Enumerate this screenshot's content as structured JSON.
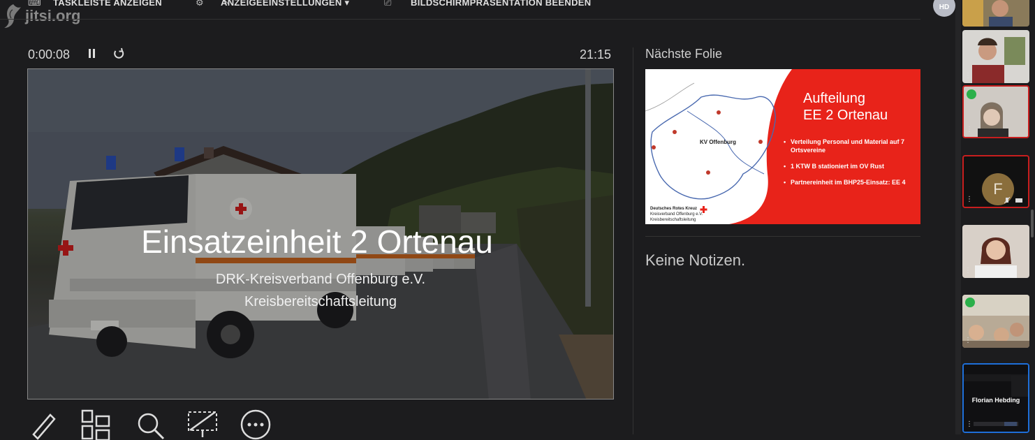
{
  "logo": {
    "text": "jitsi.org"
  },
  "toolbar": {
    "show_taskbar": "TASKLEISTE ANZEIGEN",
    "display_settings": "ANZEIGEEINSTELLUNGEN ▾",
    "end_presentation": "BILDSCHIRMPRÄSENTATION BEENDEN",
    "user_initials": "HD"
  },
  "presenter": {
    "elapsed": "0:00:08",
    "clock": "21:15",
    "next_label": "Nächste Folie",
    "notes": "Keine Notizen."
  },
  "slide": {
    "title": "Einsatzeinheit 2 Ortenau",
    "subtitle1": "DRK-Kreisverband Offenburg e.V.",
    "subtitle2": "Kreisbereitschaftsleitung"
  },
  "next_slide": {
    "title_line1": "Aufteilung",
    "title_line2": "EE 2 Ortenau",
    "bullets": [
      "Verteilung Personal und Material auf 7 Ortsvereine",
      "1 KTW B stationiert im OV Rust",
      "Partnereinheit im BHP25-Einsatz: EE 4"
    ],
    "map_label": "KV Offenburg",
    "drk_line1": "Deutsches Rotes Kreuz",
    "drk_line2": "Kreisverband Offenburg e.V.",
    "drk_line3": "Kreisbereitschaftsleitung"
  },
  "participants": {
    "avatar_letter": "F",
    "active_name": "Florian Hebding"
  },
  "colors": {
    "accent_red": "#e8231a",
    "active_border": "#1e6fd9",
    "speaker_border": "#c81e1e"
  }
}
